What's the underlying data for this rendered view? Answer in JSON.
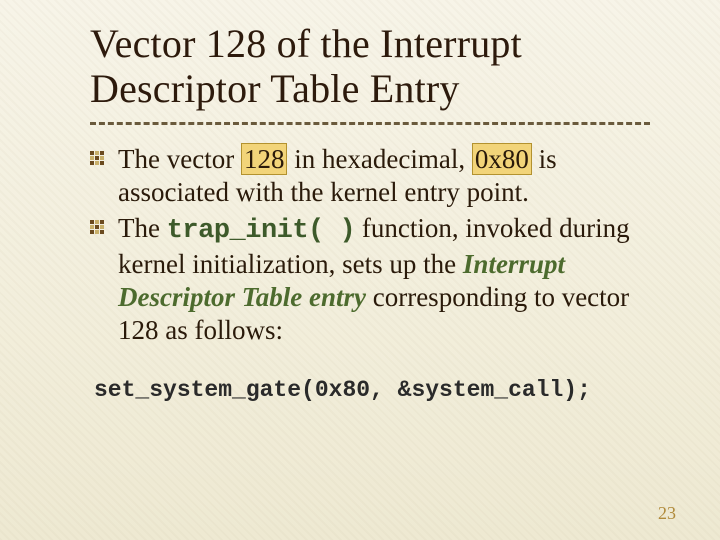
{
  "title": "Vector 128 of the Interrupt Descriptor Table Entry",
  "bullets": [
    {
      "pre1": "The vector ",
      "hl1": "128",
      "mid": " in hexadecimal, ",
      "hl2": "0x80",
      "post": " is associated with the kernel entry point."
    },
    {
      "pre": "The ",
      "code": "trap_init( )",
      "mid": " function, invoked during kernel initialization, sets up the ",
      "emph": "Interrupt Descriptor Table entry",
      "post": " corresponding to vector 128 as follows:"
    }
  ],
  "codeline": "set_system_gate(0x80, &system_call);",
  "page_number": "23"
}
